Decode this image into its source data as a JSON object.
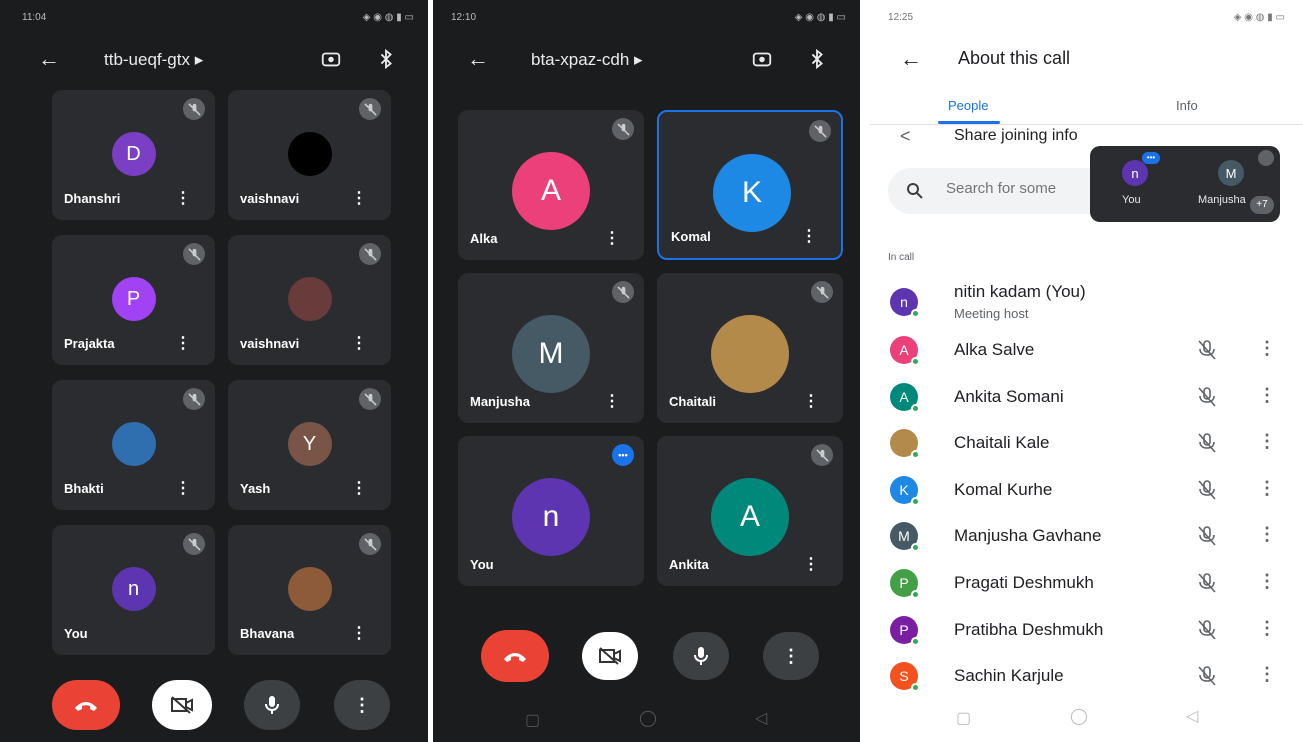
{
  "screen1": {
    "time": "11:04",
    "code": "ttb-ueqf-gtx ▸",
    "tiles": [
      {
        "name": "Dhanshri",
        "initial": "D",
        "color": "#7b3fc6"
      },
      {
        "name": "vaishnavi",
        "initial": "",
        "color": "#000000"
      },
      {
        "name": "Prajakta",
        "initial": "P",
        "color": "#a142f4"
      },
      {
        "name": "vaishnavi",
        "initial": "",
        "color": "#6a3b3b"
      },
      {
        "name": "Bhakti",
        "initial": "",
        "color": "#2f6fb0"
      },
      {
        "name": "Yash",
        "initial": "Y",
        "color": "#795548"
      },
      {
        "name": "You",
        "initial": "n",
        "color": "#5e35b1"
      },
      {
        "name": "Bhavana",
        "initial": "",
        "color": "#8d5a3a"
      }
    ]
  },
  "screen2": {
    "time": "12:10",
    "code": "bta-xpaz-cdh ▸",
    "tiles": [
      {
        "name": "Alka",
        "initial": "A",
        "color": "#ec407a"
      },
      {
        "name": "Komal",
        "initial": "K",
        "color": "#1e88e5"
      },
      {
        "name": "Manjusha",
        "initial": "M",
        "color": "#455a64"
      },
      {
        "name": "Chaitali",
        "initial": "",
        "color": "#b38a4a"
      },
      {
        "name": "You",
        "initial": "n",
        "color": "#5e35b1"
      },
      {
        "name": "Ankita",
        "initial": "A",
        "color": "#00897b"
      }
    ]
  },
  "screen3": {
    "time": "12:25",
    "title": "About this call",
    "tab_people": "People",
    "tab_info": "Info",
    "share": "Share joining info",
    "search_placeholder": "Search for some",
    "float_you": "You",
    "float_you_initial": "n",
    "float_other": "Manjusha",
    "float_other_initial": "M",
    "float_more": "+7",
    "section": "In call",
    "host": {
      "name": "nitin kadam (You)",
      "role": "Meeting host",
      "initial": "n",
      "color": "#5e35b1"
    },
    "people": [
      {
        "name": "Alka Salve",
        "initial": "A",
        "color": "#ec407a"
      },
      {
        "name": "Ankita Somani",
        "initial": "A",
        "color": "#00897b"
      },
      {
        "name": "Chaitali Kale",
        "initial": "",
        "color": "#b38a4a"
      },
      {
        "name": "Komal Kurhe",
        "initial": "K",
        "color": "#1e88e5"
      },
      {
        "name": "Manjusha Gavhane",
        "initial": "M",
        "color": "#455a64"
      },
      {
        "name": "Pragati Deshmukh",
        "initial": "P",
        "color": "#43a047"
      },
      {
        "name": "Pratibha Deshmukh",
        "initial": "P",
        "color": "#7b1fa2"
      },
      {
        "name": "Sachin Karjule",
        "initial": "S",
        "color": "#f4511e"
      }
    ]
  },
  "colors": {
    "end_call": "#ea4335",
    "accent": "#1a73e8"
  }
}
